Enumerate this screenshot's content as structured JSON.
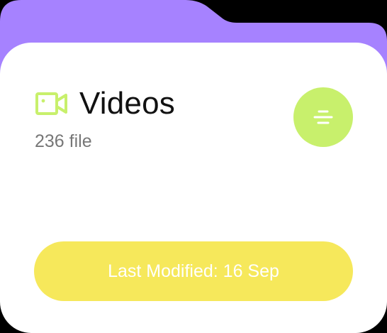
{
  "folder": {
    "title": "Videos",
    "file_count": "236 file",
    "last_modified": "Last Modified: 16 Sep",
    "icon": "video-camera-icon",
    "menu_icon": "menu-lines-icon"
  },
  "colors": {
    "folder_tab": "#a682ff",
    "card": "#ffffff",
    "accent_green": "#c8f06c",
    "accent_yellow": "#f6e85b",
    "title_text": "#111111",
    "subtitle_text": "#777777"
  }
}
